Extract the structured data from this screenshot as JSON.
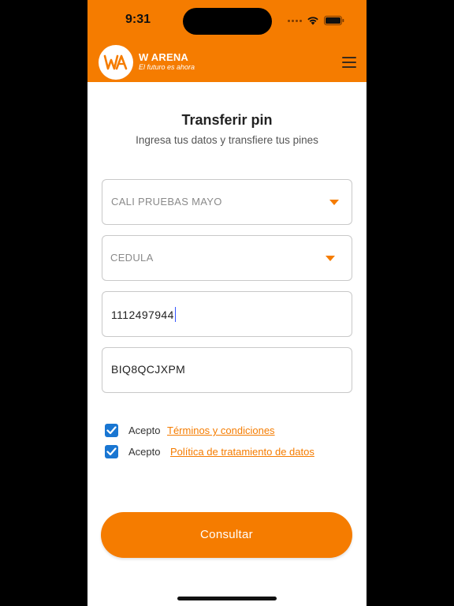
{
  "status_bar": {
    "time": "9:31"
  },
  "header": {
    "brand_name": "W ARENA",
    "tagline": "El futuro es ahora",
    "logo_icon": "wa-logo-icon",
    "menu_icon": "hamburger-menu-icon",
    "accent_color": "#f57c00"
  },
  "page": {
    "title": "Transferir pin",
    "subtitle": "Ingresa tus datos y transfiere tus pines"
  },
  "form": {
    "location_select": {
      "value": "CALI PRUEBAS MAYO"
    },
    "document_type_select": {
      "value": "CEDULA"
    },
    "document_number_input": {
      "value": "1112497944"
    },
    "pin_input": {
      "value": "BIQ8QCJXPM"
    }
  },
  "consents": {
    "terms": {
      "checked": true,
      "label": "Acepto",
      "link_text": "Términos y condiciones"
    },
    "privacy": {
      "checked": true,
      "label": "Acepto",
      "link_text": "Política de tratamiento de datos"
    }
  },
  "actions": {
    "submit_label": "Consultar"
  }
}
